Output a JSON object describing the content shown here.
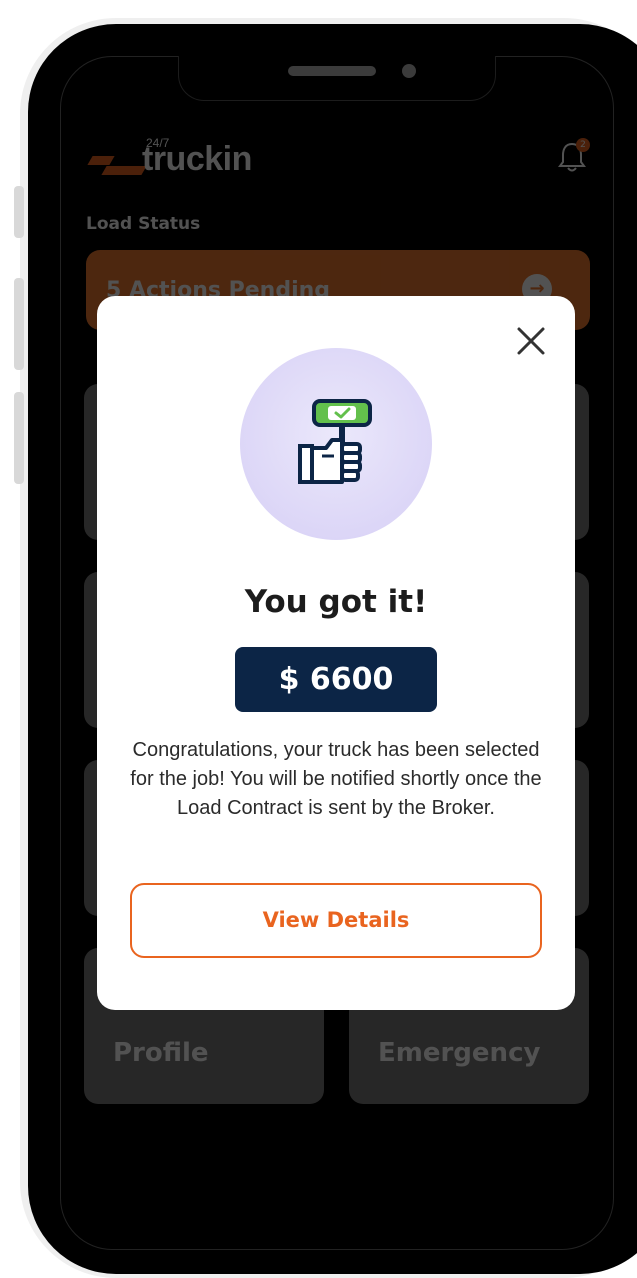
{
  "brand": {
    "name": "truckin",
    "superscript": "24/7",
    "accent": "#e9641f",
    "navy": "#0c2546"
  },
  "header": {
    "notification_count": "2"
  },
  "load_status": {
    "label": "Load Status",
    "pending_text": "5 Actions Pending"
  },
  "tiles": [
    {
      "label": ""
    },
    {
      "label": ""
    },
    {
      "label": ""
    },
    {
      "label": ""
    },
    {
      "label": ""
    },
    {
      "label": ""
    },
    {
      "label": "Profile"
    },
    {
      "label": "Emergency"
    }
  ],
  "modal": {
    "icon": "hand-holding-approval-icon",
    "title": "You got it!",
    "amount": "$ 6600",
    "message": "Congratulations, your truck has been selected for the job! You will be notified shortly once the Load Contract is sent by the Broker.",
    "button_label": "View Details",
    "close_icon": "close-icon"
  }
}
